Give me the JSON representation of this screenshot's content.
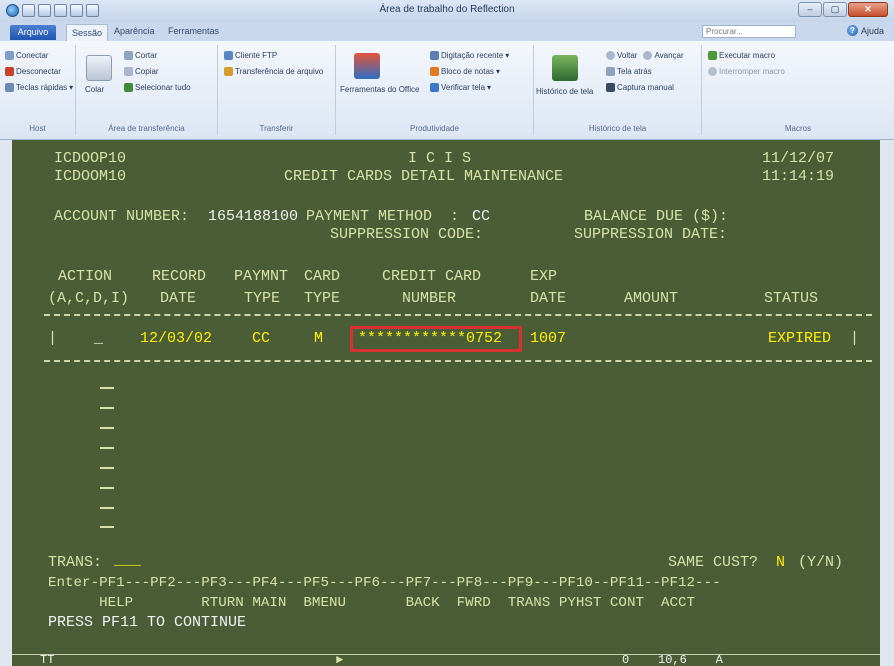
{
  "window": {
    "title": "Área de trabalho do Reflection",
    "minimize": "–",
    "maximize": "▢",
    "close": "✕"
  },
  "tabs": {
    "file": "Arquivo",
    "session": "Sessão",
    "appearance": "Aparência",
    "tools": "Ferramentas"
  },
  "search": {
    "placeholder": "Procurar..."
  },
  "help": {
    "label": "Ajuda"
  },
  "ribbon": {
    "host": {
      "connect": "Conectar",
      "disconnect": "Desconectar",
      "quick_keys": "Teclas rápidas",
      "label": "Host"
    },
    "clipboard": {
      "cut": "Cortar",
      "copy": "Copiar",
      "paste": "Colar",
      "select_all": "Selecionar tudo",
      "label": "Área de transferência"
    },
    "transfer": {
      "ftp": "Cliente FTP",
      "file_transfer": "Transferência de arquivo",
      "label": "Transferir"
    },
    "productivity": {
      "office_tools": "Ferramentas do Office",
      "recent_typing": "Digitação recente",
      "notes": "Bloco de notas",
      "spell_check": "Verificar tela",
      "label": "Produtividade"
    },
    "screen_history": {
      "history": "Histórico de tela",
      "back": "Voltar",
      "forward": "Avançar",
      "screens": "Tela atrás",
      "manual_capture": "Captura manual",
      "label": "Histórico de tela"
    },
    "macros": {
      "run_macro": "Executar macro",
      "stop": "Interromper macro",
      "label": "Macros"
    }
  },
  "terminal": {
    "prog1": "ICDOOP10",
    "prog2": "ICDOOM10",
    "system": "I C I S",
    "screen_title": "CREDIT CARDS DETAIL MAINTENANCE",
    "date": "11/12/07",
    "time": "11:14:19",
    "account_label": "ACCOUNT NUMBER:",
    "account_number": "1654188100",
    "payment_method_label": "PAYMENT METHOD  :",
    "payment_method": "CC",
    "balance_label": "BALANCE DUE ($):",
    "suppression_code_label": "SUPPRESSION CODE:",
    "suppression_date_label": "SUPPRESSION DATE:",
    "headers_top": {
      "action": "ACTION",
      "record": "RECORD",
      "paymnt": "PAYMNT",
      "card": "CARD",
      "ccnum": "CREDIT CARD",
      "exp": "EXP"
    },
    "headers_bot": {
      "action": "(A,C,D,I)",
      "record": "DATE",
      "paymnt": "TYPE",
      "card": "TYPE",
      "ccnum": "NUMBER",
      "exp": "DATE",
      "amount": "AMOUNT",
      "status": "STATUS"
    },
    "row": {
      "left_border": "|",
      "action": "_",
      "record_date": "12/03/02",
      "payment_type": "CC",
      "card_type": "M",
      "card_number": "************0752",
      "exp_date": "1007",
      "amount": "",
      "status": "EXPIRED",
      "right_border": "|"
    },
    "trans_label": "TRANS:",
    "trans_value": "___",
    "same_cust_label": "SAME CUST?",
    "same_cust_value": "N",
    "same_cust_hint": "(Y/N)",
    "pf_line": "Enter-PF1---PF2---PF3---PF4---PF5---PF6---PF7---PF8---PF9---PF10--PF11--PF12---",
    "pf_labels": "      HELP        RTURN MAIN  BMENU       BACK  FWRD  TRANS PYHST CONT  ACCT",
    "message": "PRESS PF11 TO CONTINUE",
    "status_left": "TT",
    "status_mid": "►",
    "status_right": "0    10,6    A"
  },
  "colors": {
    "terminal_bg": "#4a5d37",
    "highlight": "#ffef00",
    "selection_box": "#d83232"
  }
}
